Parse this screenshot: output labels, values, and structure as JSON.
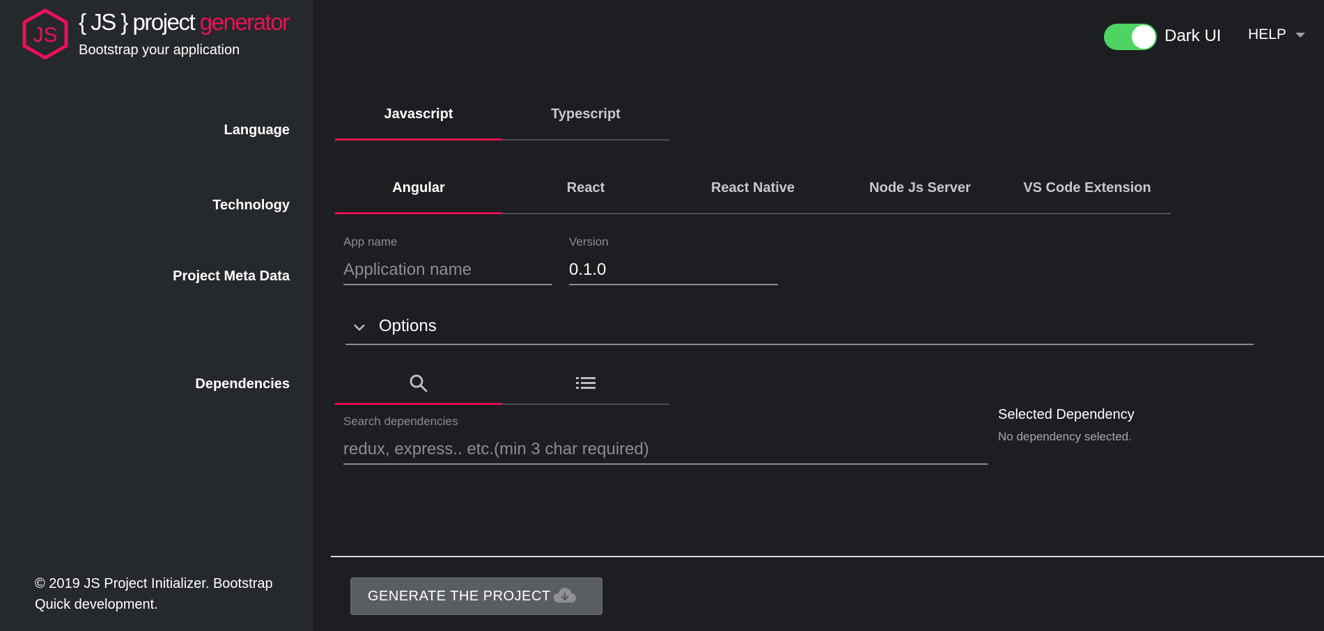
{
  "brand": {
    "title_prefix": "{ JS } project ",
    "title_accent": "generator",
    "subtitle": "Bootstrap your application",
    "logo_text": "JS"
  },
  "colors": {
    "accent": "#e4114f",
    "toggle_on": "#4fd463",
    "background": "#1c1e22",
    "sidebar": "#25282c"
  },
  "header": {
    "toggle": {
      "label": "Dark UI",
      "on": true
    },
    "help_label": "HELP"
  },
  "sections": {
    "language": "Language",
    "technology": "Technology",
    "meta": "Project Meta Data",
    "dependencies": "Dependencies"
  },
  "language_tabs": [
    {
      "label": "Javascript",
      "active": true
    },
    {
      "label": "Typescript",
      "active": false
    }
  ],
  "technology_tabs": [
    {
      "label": "Angular",
      "active": true
    },
    {
      "label": "React",
      "active": false
    },
    {
      "label": "React Native",
      "active": false
    },
    {
      "label": "Node Js Server",
      "active": false
    },
    {
      "label": "VS Code Extension",
      "active": false
    }
  ],
  "meta": {
    "app_name": {
      "label": "App name",
      "placeholder": "Application name",
      "value": ""
    },
    "version": {
      "label": "Version",
      "value": "0.1.0"
    }
  },
  "options": {
    "label": "Options",
    "icon": "chevron-down-icon"
  },
  "dependency_tabs": [
    {
      "icon": "search-icon",
      "active": true
    },
    {
      "icon": "list-icon",
      "active": false
    }
  ],
  "search": {
    "label": "Search dependencies",
    "placeholder": "redux, express.. etc.(min 3 char required)"
  },
  "selected": {
    "title": "Selected Dependency",
    "empty": "No dependency selected."
  },
  "footer": {
    "text": "© 2019 JS Project Initializer. Bootstrap Quick development."
  },
  "generate": {
    "label": "GENERATE THE PROJECT",
    "icon": "cloud-download-icon"
  }
}
